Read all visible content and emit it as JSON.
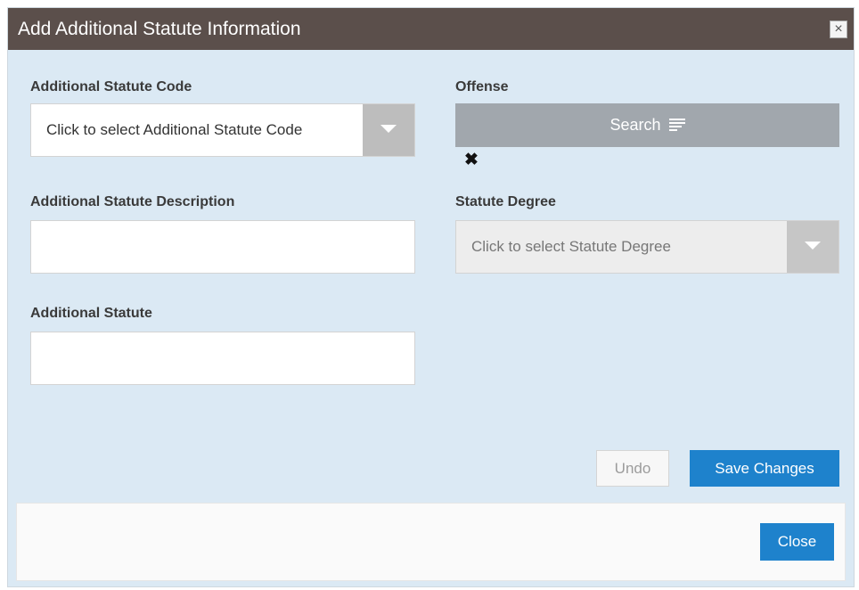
{
  "dialog": {
    "title": "Add Additional Statute Information",
    "close_glyph": "×"
  },
  "form": {
    "statute_code": {
      "label": "Additional Statute Code",
      "placeholder": "Click to select Additional Statute Code"
    },
    "offense": {
      "label": "Offense",
      "search_label": "Search",
      "clear_glyph": "✖"
    },
    "statute_description": {
      "label": "Additional Statute Description",
      "value": ""
    },
    "statute_degree": {
      "label": "Statute Degree",
      "placeholder": "Click to select Statute Degree"
    },
    "additional_statute": {
      "label": "Additional Statute",
      "value": ""
    }
  },
  "actions": {
    "undo_label": "Undo",
    "save_label": "Save Changes"
  },
  "footer": {
    "close_label": "Close"
  },
  "colors": {
    "titlebar": "#5b4f4b",
    "dialog_bg": "#dbe9f4",
    "primary": "#1e82cc",
    "search_button": "#a1a7ad"
  },
  "icons": {
    "dialog_close": "close-icon",
    "search": "list-lines-icon",
    "dropdown": "caret-down-icon",
    "clear": "clear-x-icon"
  }
}
